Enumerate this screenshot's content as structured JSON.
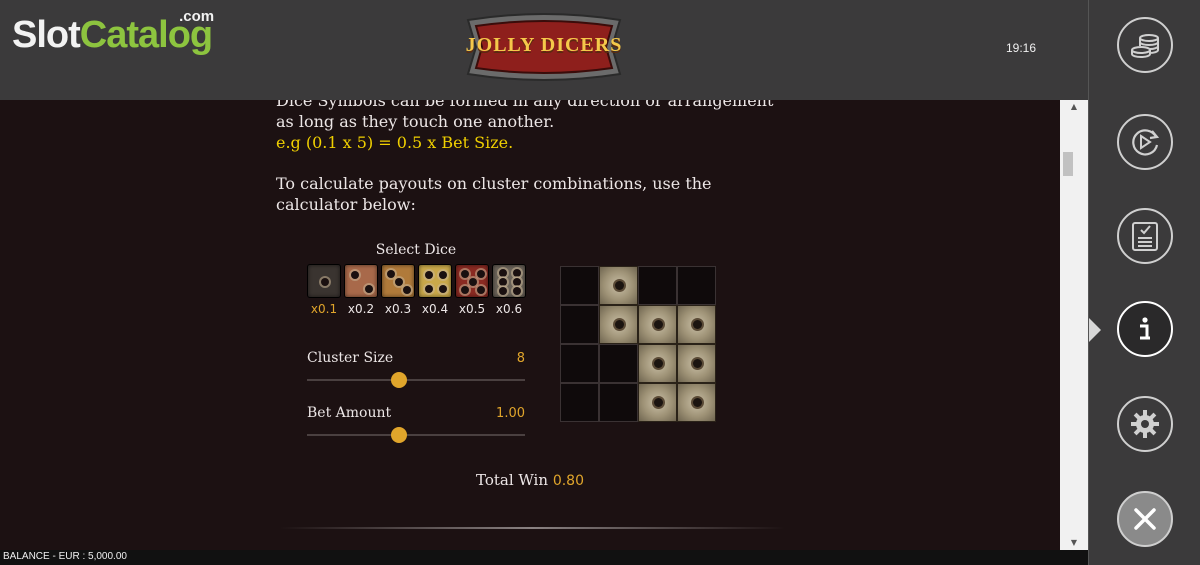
{
  "brand": {
    "slot": "Slot",
    "catalog": "Catalog",
    "com": ".com"
  },
  "game_title": "JOLLY DICERS",
  "clock": "19:16",
  "rules": {
    "paragraph1": "Dice Symbols can be formed in any direction or arrangement as long as they touch one another.",
    "example": "e.g (0.1 x 5) = 0.5 x Bet Size.",
    "paragraph2": "To calculate payouts on cluster combinations, use the calculator below:"
  },
  "calculator": {
    "select_dice_title": "Select Dice",
    "dice": [
      {
        "label": "x0.1",
        "selected": true,
        "color": "#3a3430",
        "pips": 1
      },
      {
        "label": "x0.2",
        "selected": false,
        "color": "#a8694a",
        "pips": 2
      },
      {
        "label": "x0.3",
        "selected": false,
        "color": "#b07a3a",
        "pips": 3
      },
      {
        "label": "x0.4",
        "selected": false,
        "color": "#c9a84a",
        "pips": 4
      },
      {
        "label": "x0.5",
        "selected": false,
        "color": "#8a2a22",
        "pips": 5
      },
      {
        "label": "x0.6",
        "selected": false,
        "color": "#6a6258",
        "pips": 6
      }
    ],
    "cluster_size": {
      "label": "Cluster Size",
      "value": "8",
      "level": 0.42
    },
    "bet_amount": {
      "label": "Bet Amount",
      "value": "1.00",
      "level": 0.42
    },
    "grid": [
      [
        0,
        1,
        0,
        0
      ],
      [
        0,
        1,
        1,
        1
      ],
      [
        0,
        0,
        1,
        1
      ],
      [
        0,
        0,
        1,
        1
      ]
    ],
    "total_win_label": "Total Win",
    "total_win_value": "0.80"
  },
  "balance": "BALANCE - EUR : 5,000.00",
  "sidebar": {
    "buttons": [
      "coins-icon",
      "autoplay-icon",
      "paytable-icon",
      "info-icon",
      "settings-icon",
      "close-icon"
    ],
    "active": "info-icon"
  },
  "colors": {
    "accent": "#e0a52b",
    "example_text": "#f0d000",
    "brand_green": "#8dc43f"
  }
}
